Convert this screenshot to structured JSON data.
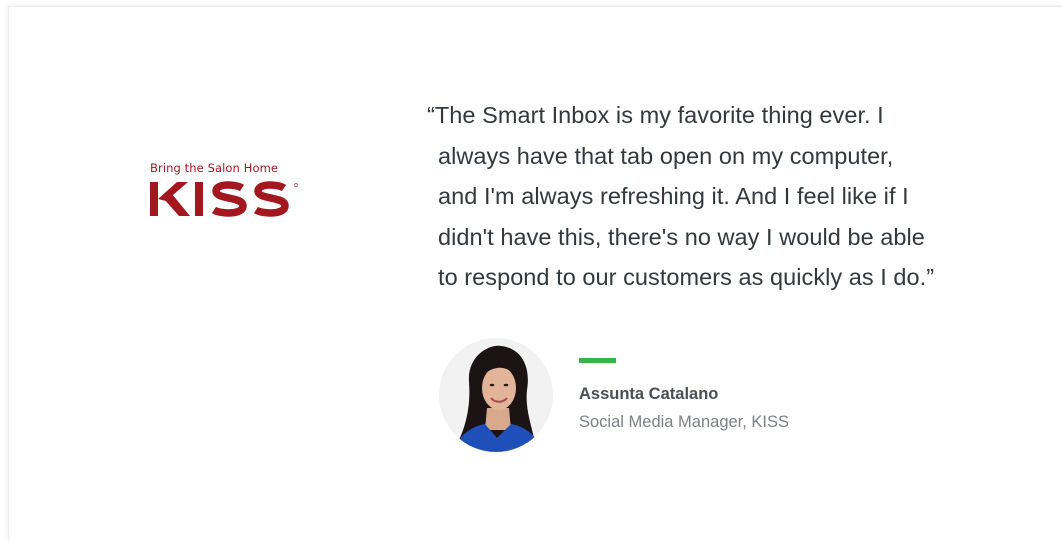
{
  "brand": {
    "tagline": "Bring the Salon Home",
    "wordmark": "KISS",
    "color": "#a3171f"
  },
  "testimonial": {
    "quote_lines": [
      "“The Smart Inbox is my favorite thing ever. I",
      "always have that tab open on my computer,",
      "and I'm always refreshing it. And I feel like if I",
      "didn't have this, there's no way I would be able",
      "to respond to our customers as quickly as I do.”"
    ],
    "accent_color": "#3bb54a"
  },
  "person": {
    "name": "Assunta Catalano",
    "title": "Social Media Manager, KISS"
  }
}
